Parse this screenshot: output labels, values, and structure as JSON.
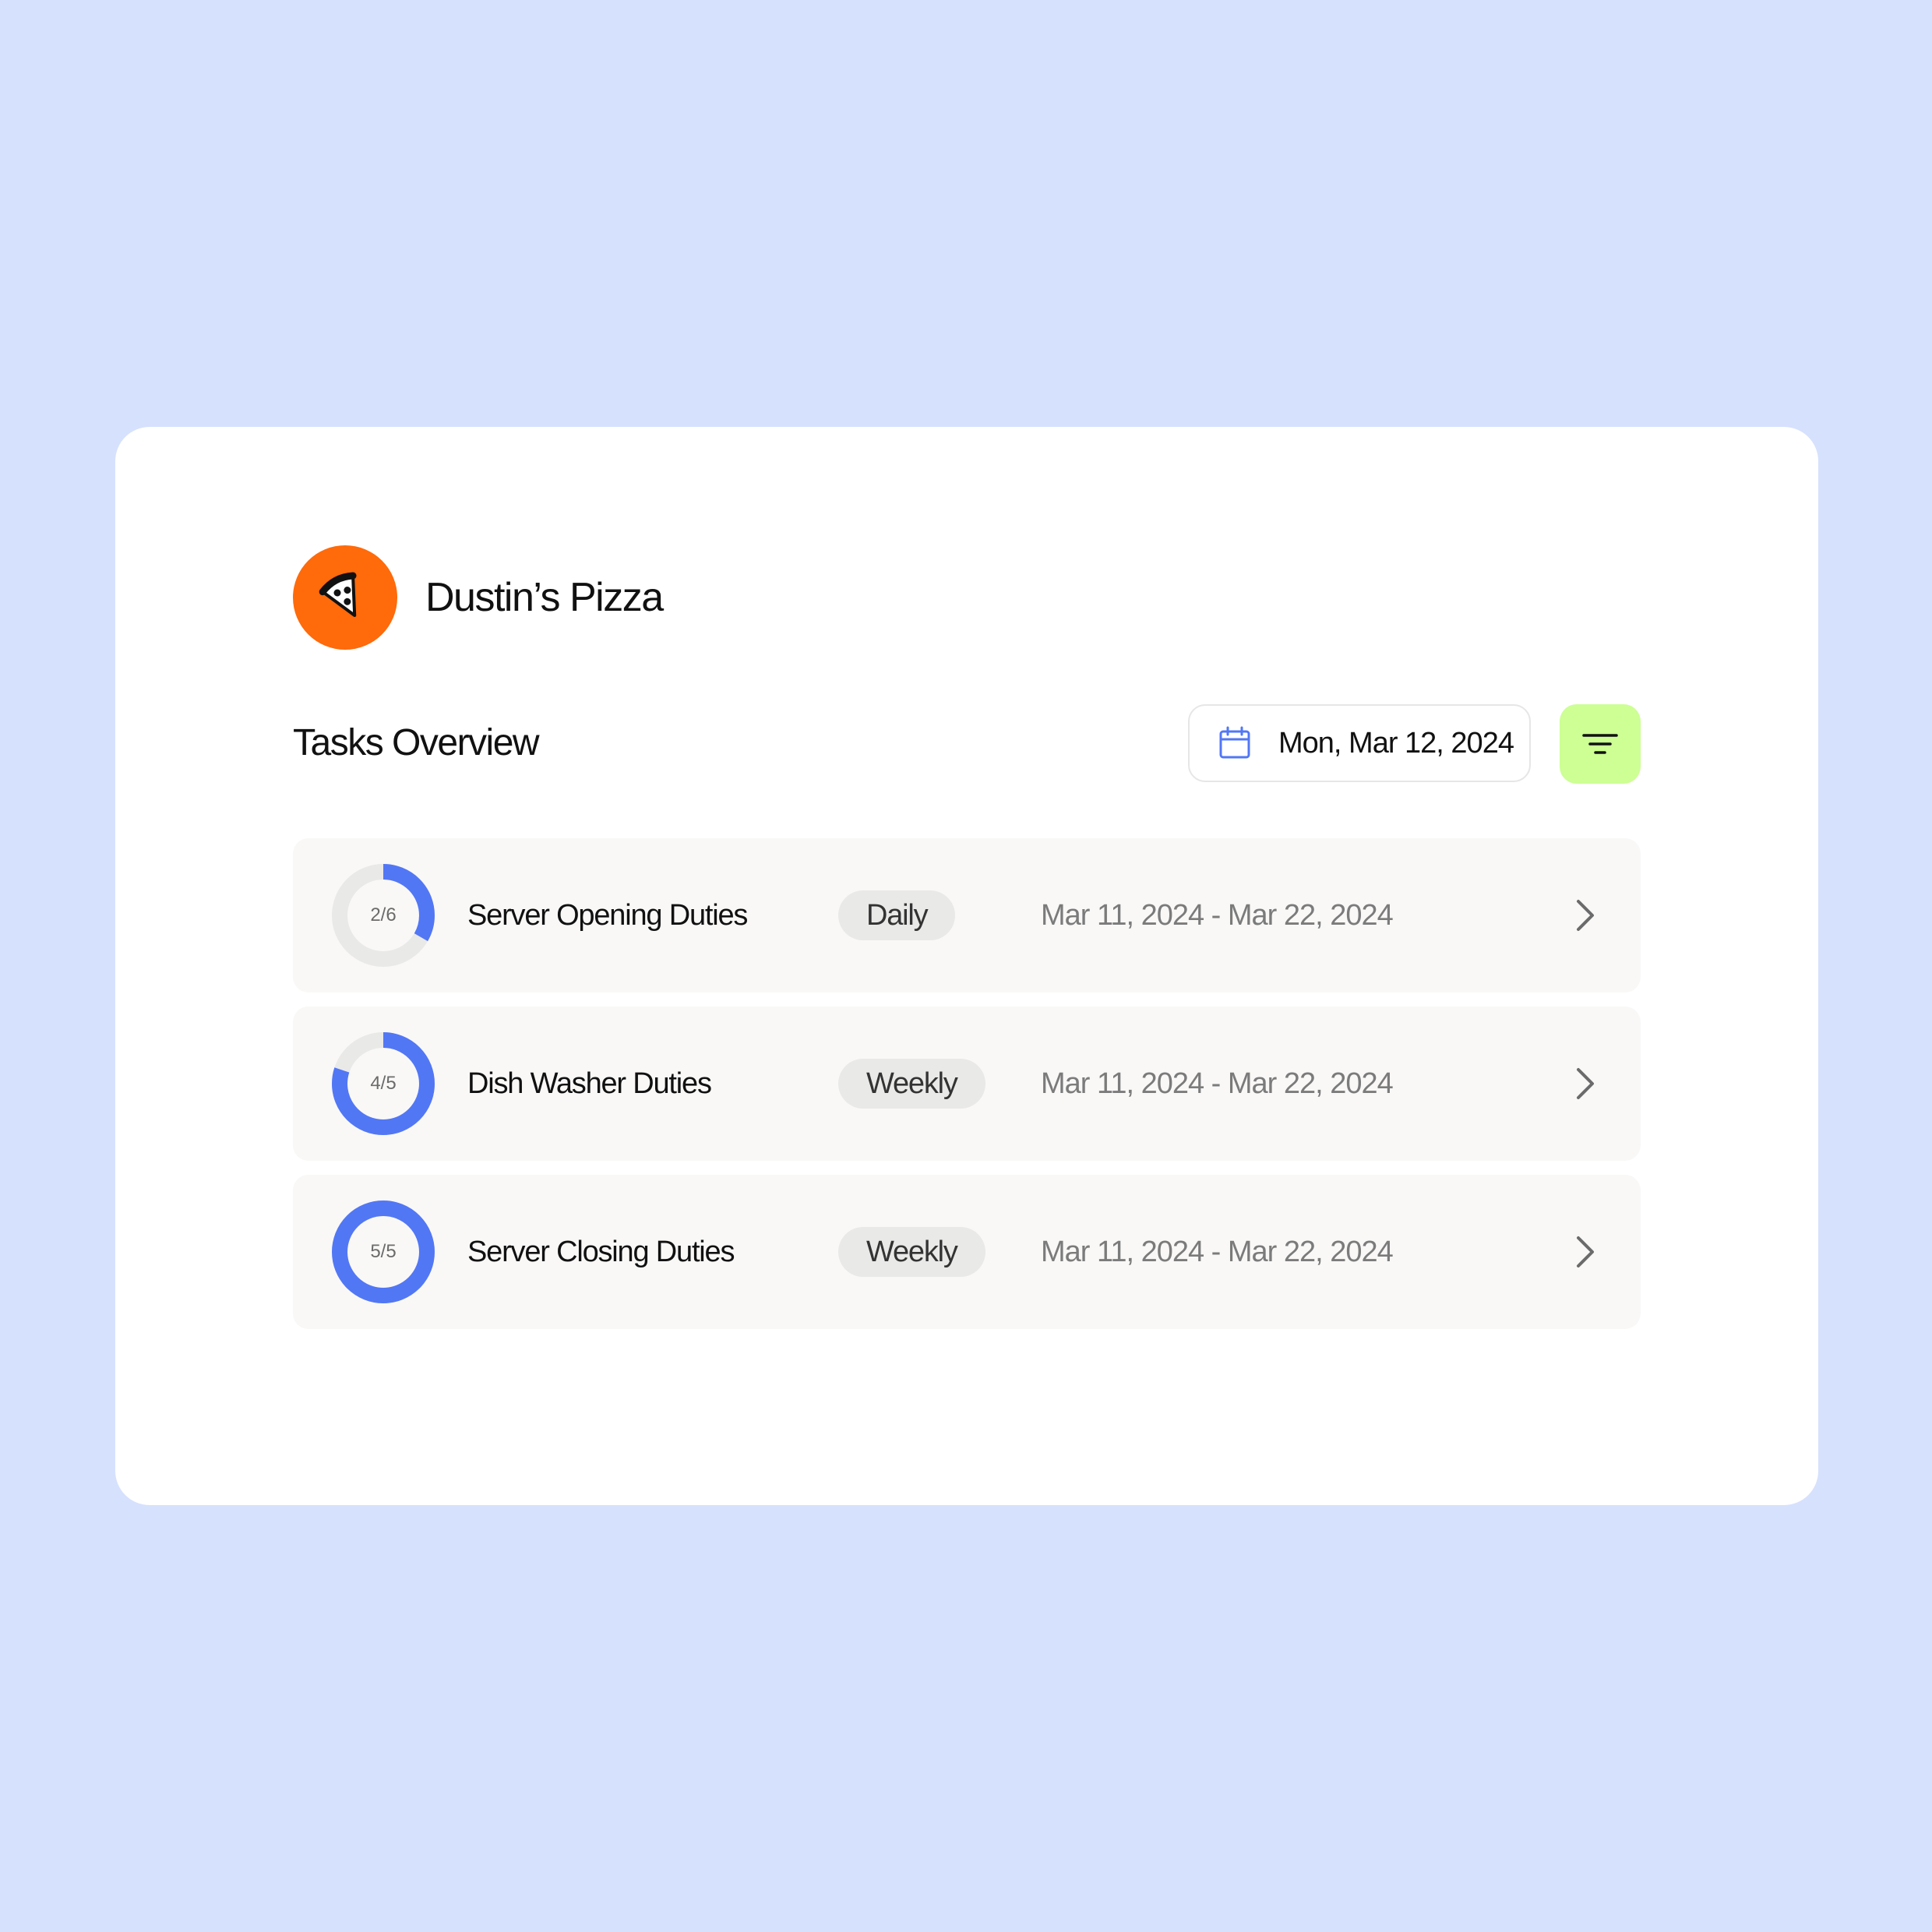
{
  "brand": {
    "name": "Dustin’s Pizza",
    "logo_icon": "pizza-slice-icon",
    "logo_color": "#ff6a0b"
  },
  "overview": {
    "title": "Tasks Overview",
    "date_picker": {
      "icon": "calendar-icon",
      "value": "Mon, Mar 12, 2024"
    },
    "filter_button": {
      "icon": "filter-icon",
      "color": "#cdff94"
    }
  },
  "colors": {
    "page_background": "#d6e1fd",
    "progress_fill": "#5277f5",
    "progress_track": "#e9e9e7"
  },
  "tasks": [
    {
      "name": "Server Opening Duties",
      "progress_label": "2/6",
      "completed": 2,
      "total": 6,
      "frequency": "Daily",
      "date_range": "Mar 11, 2024 - Mar 22, 2024"
    },
    {
      "name": "Dish Washer Duties",
      "progress_label": "4/5",
      "completed": 4,
      "total": 5,
      "frequency": "Weekly",
      "date_range": "Mar 11, 2024 - Mar 22, 2024"
    },
    {
      "name": "Server Closing Duties",
      "progress_label": "5/5",
      "completed": 5,
      "total": 5,
      "frequency": "Weekly",
      "date_range": "Mar 11, 2024 - Mar 22, 2024"
    }
  ]
}
